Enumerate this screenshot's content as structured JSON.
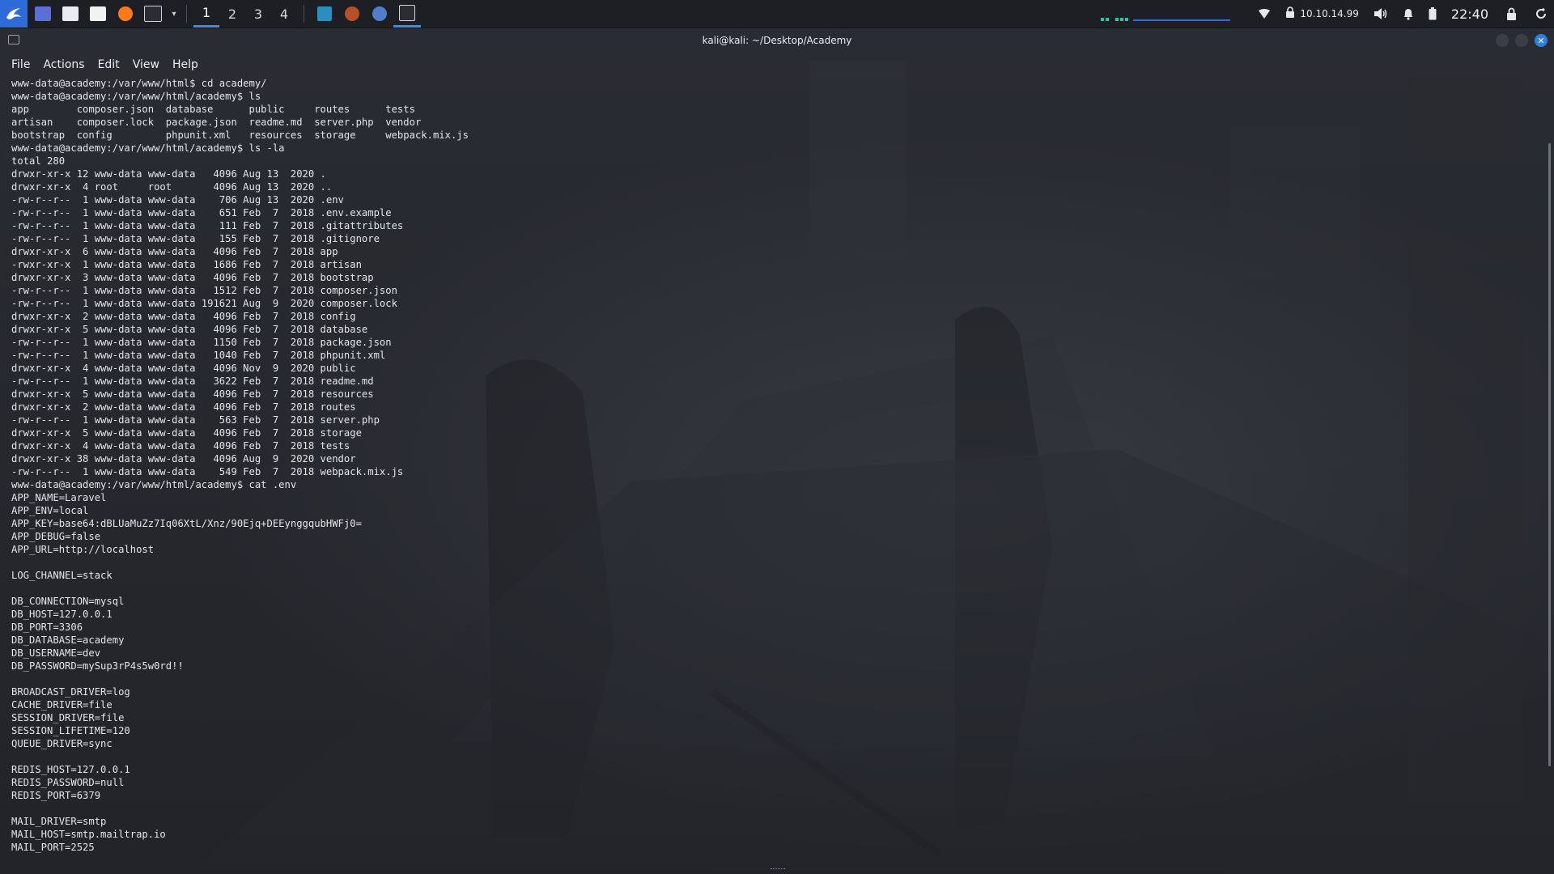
{
  "panel": {
    "launchers": [
      {
        "name": "show-desktop-icon",
        "color": "#5b6fd6"
      },
      {
        "name": "file-manager-icon",
        "color": "#e9ecf2"
      },
      {
        "name": "text-editor-icon",
        "color": "#f2f2f2"
      },
      {
        "name": "firefox-icon",
        "color": "#ff7a1a"
      },
      {
        "name": "terminal-icon",
        "color": "#2b2d33"
      }
    ],
    "workspaces": [
      "1",
      "2",
      "3",
      "4"
    ],
    "active_workspace": "1",
    "tasks": [
      {
        "name": "task-vscode-icon",
        "color": "#2a8fbd"
      },
      {
        "name": "task-firefox-icon",
        "color": "#b4502a"
      },
      {
        "name": "task-browser-icon",
        "color": "#4f7fc9"
      },
      {
        "name": "task-terminal-icon",
        "color": "#2b2d33"
      }
    ],
    "ip": "10.10.14.99",
    "clock": "22:40",
    "accent": "#3b8beb"
  },
  "window": {
    "title": "kali@kali: ~/Desktop/Academy",
    "menu": [
      "File",
      "Actions",
      "Edit",
      "View",
      "Help"
    ]
  },
  "terminal": {
    "lines": [
      "www-data@academy:/var/www/html$ cd academy/",
      "www-data@academy:/var/www/html/academy$ ls",
      "app        composer.json  database      public     routes      tests",
      "artisan    composer.lock  package.json  readme.md  server.php  vendor",
      "bootstrap  config         phpunit.xml   resources  storage     webpack.mix.js",
      "www-data@academy:/var/www/html/academy$ ls -la",
      "total 280",
      "drwxr-xr-x 12 www-data www-data   4096 Aug 13  2020 .",
      "drwxr-xr-x  4 root     root       4096 Aug 13  2020 ..",
      "-rw-r--r--  1 www-data www-data    706 Aug 13  2020 .env",
      "-rw-r--r--  1 www-data www-data    651 Feb  7  2018 .env.example",
      "-rw-r--r--  1 www-data www-data    111 Feb  7  2018 .gitattributes",
      "-rw-r--r--  1 www-data www-data    155 Feb  7  2018 .gitignore",
      "drwxr-xr-x  6 www-data www-data   4096 Feb  7  2018 app",
      "-rwxr-xr-x  1 www-data www-data   1686 Feb  7  2018 artisan",
      "drwxr-xr-x  3 www-data www-data   4096 Feb  7  2018 bootstrap",
      "-rw-r--r--  1 www-data www-data   1512 Feb  7  2018 composer.json",
      "-rw-r--r--  1 www-data www-data 191621 Aug  9  2020 composer.lock",
      "drwxr-xr-x  2 www-data www-data   4096 Feb  7  2018 config",
      "drwxr-xr-x  5 www-data www-data   4096 Feb  7  2018 database",
      "-rw-r--r--  1 www-data www-data   1150 Feb  7  2018 package.json",
      "-rw-r--r--  1 www-data www-data   1040 Feb  7  2018 phpunit.xml",
      "drwxr-xr-x  4 www-data www-data   4096 Nov  9  2020 public",
      "-rw-r--r--  1 www-data www-data   3622 Feb  7  2018 readme.md",
      "drwxr-xr-x  5 www-data www-data   4096 Feb  7  2018 resources",
      "drwxr-xr-x  2 www-data www-data   4096 Feb  7  2018 routes",
      "-rw-r--r--  1 www-data www-data    563 Feb  7  2018 server.php",
      "drwxr-xr-x  5 www-data www-data   4096 Feb  7  2018 storage",
      "drwxr-xr-x  4 www-data www-data   4096 Feb  7  2018 tests",
      "drwxr-xr-x 38 www-data www-data   4096 Aug  9  2020 vendor",
      "-rw-r--r--  1 www-data www-data    549 Feb  7  2018 webpack.mix.js",
      "www-data@academy:/var/www/html/academy$ cat .env",
      "APP_NAME=Laravel",
      "APP_ENV=local",
      "APP_KEY=base64:dBLUaMuZz7Iq06XtL/Xnz/90Ejq+DEEynggqubHWFj0=",
      "APP_DEBUG=false",
      "APP_URL=http://localhost",
      "",
      "LOG_CHANNEL=stack",
      "",
      "DB_CONNECTION=mysql",
      "DB_HOST=127.0.0.1",
      "DB_PORT=3306",
      "DB_DATABASE=academy",
      "DB_USERNAME=dev",
      "DB_PASSWORD=mySup3rP4s5w0rd!!",
      "",
      "BROADCAST_DRIVER=log",
      "CACHE_DRIVER=file",
      "SESSION_DRIVER=file",
      "SESSION_LIFETIME=120",
      "QUEUE_DRIVER=sync",
      "",
      "REDIS_HOST=127.0.0.1",
      "REDIS_PASSWORD=null",
      "REDIS_PORT=6379",
      "",
      "MAIL_DRIVER=smtp",
      "MAIL_HOST=smtp.mailtrap.io",
      "MAIL_PORT=2525"
    ]
  }
}
